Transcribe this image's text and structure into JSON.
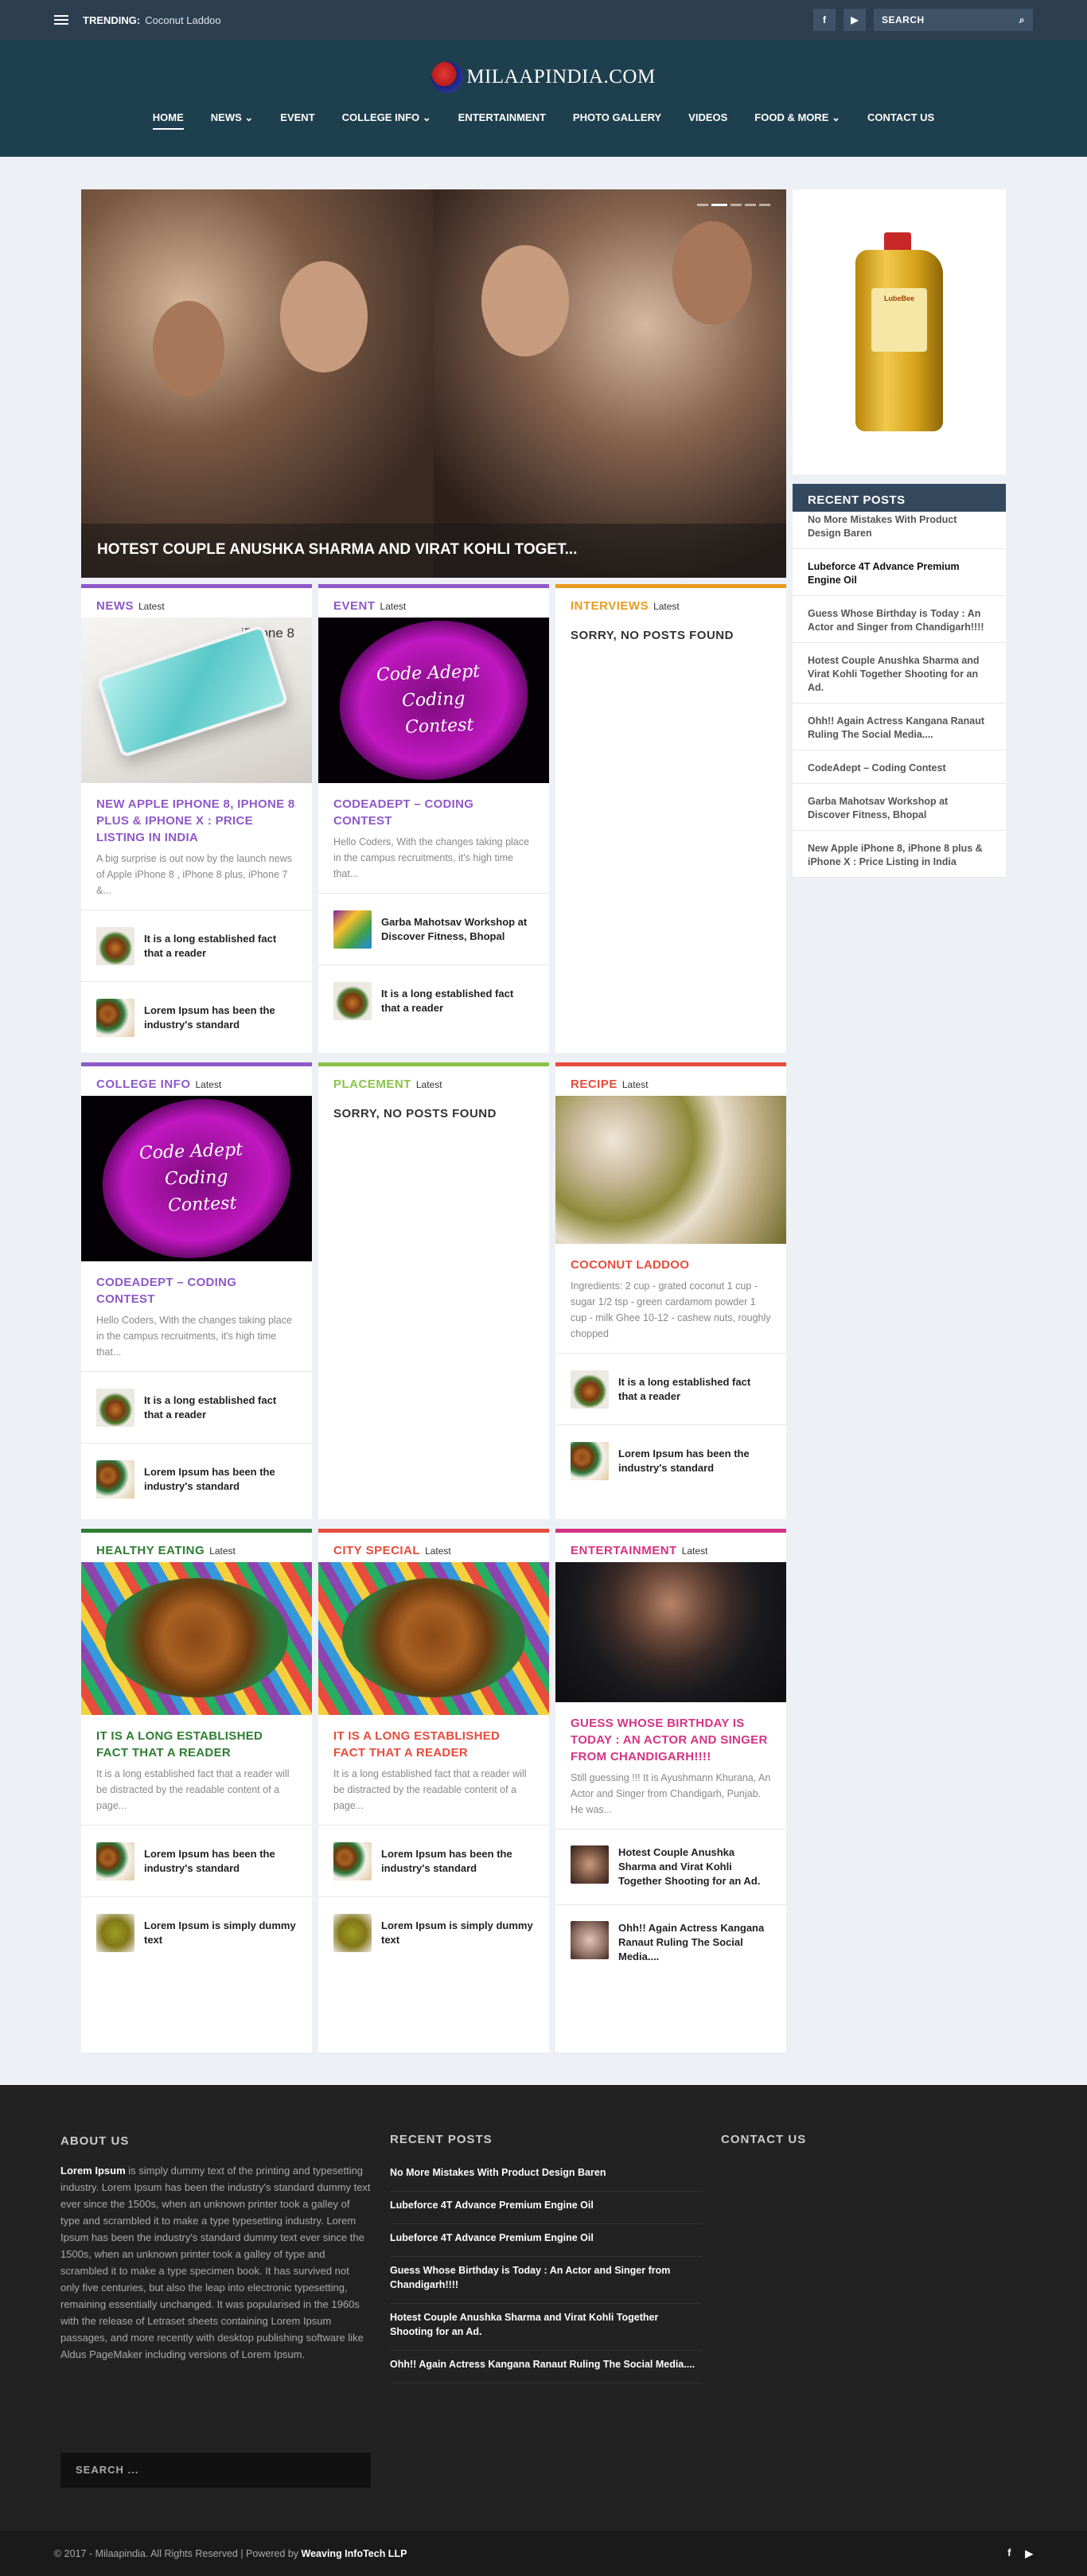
{
  "topbar": {
    "trending_label": "TRENDING:",
    "trending_value": "Coconut Laddoo",
    "facebook": "f",
    "youtube": "▶",
    "search_label": "SEARCH",
    "search_icon": "⌕"
  },
  "logo_text": "MILAAPINDIA.COM",
  "nav": [
    {
      "label": "HOME"
    },
    {
      "label": "NEWS ⌄"
    },
    {
      "label": "EVENT"
    },
    {
      "label": "COLLEGE INFO ⌄"
    },
    {
      "label": "ENTERTAINMENT"
    },
    {
      "label": "PHOTO GALLERY"
    },
    {
      "label": "VIDEOS"
    },
    {
      "label": "FOOD & MORE ⌄"
    },
    {
      "label": "CONTACT US"
    }
  ],
  "hero": {
    "title": "HOTEST COUPLE ANUSHKA SHARMA AND VIRAT KOHLI TOGET..."
  },
  "latest_label": "Latest",
  "no_posts": "SORRY, NO POSTS FOUND",
  "cards": {
    "news": {
      "cat": "NEWS",
      "color": "#8e59c8",
      "title": "NEW APPLE IPHONE 8, IPHONE 8 PLUS & IPHONE X : PRICE LISTING IN INDIA",
      "excerpt": "A big surprise is out now by the launch news of Apple iPhone 8 , iPhone 8 plus, iPhone 7 &...",
      "img_text": "iPhone 8",
      "m1": "It is a long established fact that a reader",
      "m2": "Lorem Ipsum has been the industry's standard"
    },
    "event": {
      "cat": "EVENT",
      "color": "#8e59c8",
      "title": "CODEADEPT – CODING CONTEST",
      "excerpt": "Hello Coders, With the changes taking place in the campus recruitments, it's high time that...",
      "img1": "Code Adept",
      "img2": "Coding",
      "img3": "Contest",
      "m1": "Garba Mahotsav Workshop at Discover Fitness, Bhopal",
      "m2": "It is a long established fact that a reader"
    },
    "interviews": {
      "cat": "INTERVIEWS",
      "color": "#e89b1e"
    },
    "college": {
      "cat": "COLLEGE INFO",
      "color": "#8e59c8",
      "title": "CODEADEPT – CODING CONTEST",
      "excerpt": "Hello Coders, With the changes taking place in the campus recruitments, it's high time that...",
      "img1": "Code Adept",
      "img2": "Coding",
      "img3": "Contest",
      "m1": "It is a long established fact that a reader",
      "m2": "Lorem Ipsum has been the industry's standard"
    },
    "placement": {
      "cat": "PLACEMENT",
      "color": "#8bc34a"
    },
    "recipe": {
      "cat": "RECIPE",
      "color": "#e74c3c",
      "title": "COCONUT LADDOO",
      "excerpt": "Ingredients: 2 cup - grated coconut 1 cup - sugar 1/2 tsp - green cardamom powder 1 cup - milk Ghee 10-12 - cashew nuts, roughly chopped",
      "m1": "It is a long established fact that a reader",
      "m2": "Lorem Ipsum has been the industry's standard"
    },
    "healthy": {
      "cat": "HEALTHY EATING",
      "color": "#2e7d32",
      "title": "IT IS A LONG ESTABLISHED FACT THAT A READER",
      "excerpt": "It is a long established fact that a reader will be distracted by the readable content of a page...",
      "m1": "Lorem Ipsum has been the industry's standard",
      "m2": "Lorem Ipsum is simply dummy text"
    },
    "city": {
      "cat": "CITY SPECIAL",
      "color": "#e74c3c",
      "title": "IT IS A LONG ESTABLISHED FACT THAT A READER",
      "excerpt": "It is a long established fact that a reader will be distracted by the readable content of a page...",
      "m1": "Lorem Ipsum has been the industry's standard",
      "m2": "Lorem Ipsum is simply dummy text"
    },
    "entertainment": {
      "cat": "ENTERTAINMENT",
      "color": "#d63384",
      "title": "GUESS WHOSE BIRTHDAY IS TODAY : AN ACTOR AND SINGER FROM CHANDIGARH!!!!",
      "excerpt": "Still guessing !!! It is Ayushmann Khurana, An Actor and Singer from Chandigarh, Punjab. He was...",
      "m1": "Hotest Couple Anushka Sharma and Virat Kohli Together Shooting for an Ad.",
      "m2": "Ohh!! Again Actress Kangana Ranaut Ruling The Social Media...."
    }
  },
  "sidebar": {
    "bottle_brand": "LubeBee",
    "recent_title": "RECENT POSTS",
    "items": [
      "No More Mistakes With Product Design Baren",
      "Lubeforce 4T Advance Premium Engine Oil",
      "Guess Whose Birthday is Today : An Actor and Singer from Chandigarh!!!!",
      "Hotest Couple Anushka Sharma and Virat Kohli Together Shooting for an Ad.",
      "Ohh!! Again Actress Kangana Ranaut Ruling The Social Media....",
      "CodeAdept – Coding Contest",
      "Garba Mahotsav Workshop at Discover Fitness, Bhopal",
      "New Apple iPhone 8, iPhone 8 plus & iPhone X : Price Listing in India"
    ]
  },
  "footer": {
    "about_title": "ABOUT US",
    "about_lead": "Lorem Ipsum",
    "about_text": " is simply dummy text of the printing and typesetting industry. Lorem Ipsum has been the industry's standard dummy text ever since the 1500s, when an unknown printer took a galley of type and scrambled it to make a type typesetting industry. Lorem Ipsum has been the industry's standard dummy text ever since the 1500s, when an unknown printer took a galley of type and scrambled it to make a type specimen book. It has survived not only five centuries, but also the leap into electronic typesetting, remaining essentially unchanged. It was popularised in the 1960s with the release of Letraset sheets containing Lorem Ipsum passages, and more recently with desktop publishing software like Aldus PageMaker including versions of Lorem Ipsum.",
    "recent_title": "RECENT POSTS",
    "recent": [
      "No More Mistakes With Product Design Baren",
      "Lubeforce 4T Advance Premium Engine Oil",
      "Lubeforce 4T Advance Premium Engine Oil",
      "Guess Whose Birthday is Today : An Actor and Singer from Chandigarh!!!!",
      "Hotest Couple Anushka Sharma and Virat Kohli Together Shooting for an Ad.",
      "Ohh!! Again Actress Kangana Ranaut Ruling The Social Media...."
    ],
    "contact_title": "CONTACT US",
    "search_placeholder": "SEARCH ...",
    "copyright": "© 2017 - Milaapindia. All Rights Reserved | Powered by ",
    "powered_by": "Weaving InfoTech LLP"
  }
}
